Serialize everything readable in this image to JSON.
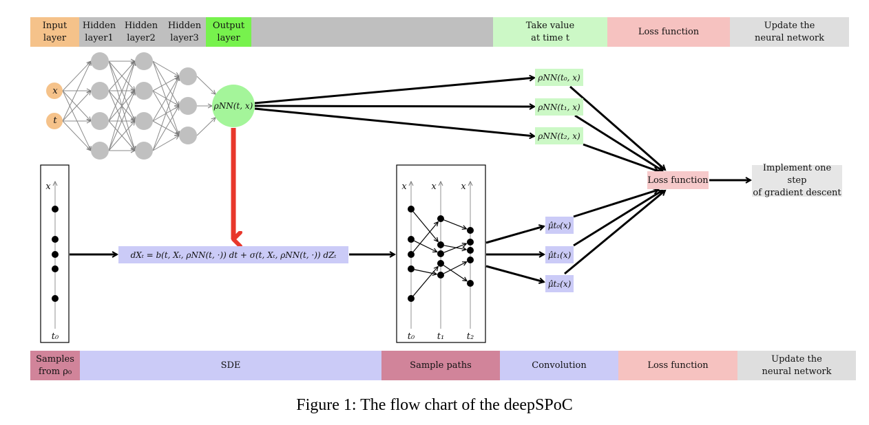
{
  "colors": {
    "input": "#f5c28a",
    "hidden": "#bfbfbf",
    "output": "#77f24d",
    "take_value": "#ccf8c6",
    "loss": "#f6c2c0",
    "update": "#dedede",
    "samples": "#d1849a",
    "sde": "#cbcbf7",
    "convolution": "#cbcbf7",
    "sample_paths": "#d1849a",
    "output_node": "#a4f59a",
    "red_arrow": "#e8372b"
  },
  "top_bar": [
    {
      "key": "input",
      "label": "Input\nlayer"
    },
    {
      "key": "hidden",
      "label": "Hidden\nlayer1"
    },
    {
      "key": "hidden",
      "label": "Hidden\nlayer2"
    },
    {
      "key": "hidden",
      "label": "Hidden\nlayer3"
    },
    {
      "key": "output",
      "label": "Output\nlayer"
    },
    {
      "key": "hidden",
      "label": ""
    },
    {
      "key": "take_value",
      "label": "Take value\nat time t"
    },
    {
      "key": "loss",
      "label": "Loss function"
    },
    {
      "key": "update",
      "label": "Update the\nneural network"
    }
  ],
  "bottom_bar": [
    {
      "key": "samples",
      "label": "Samples\nfrom ρ₀"
    },
    {
      "key": "sde",
      "label": "SDE"
    },
    {
      "key": "sample_paths",
      "label": "Sample paths"
    },
    {
      "key": "convolution",
      "label": "Convolution"
    },
    {
      "key": "loss",
      "label": "Loss function"
    },
    {
      "key": "update",
      "label": "Update the\nneural network"
    }
  ],
  "network": {
    "inputs": [
      "x",
      "t"
    ],
    "hidden_layer_sizes": [
      4,
      4,
      3
    ],
    "output": "ρNN(t, x)"
  },
  "rho_outputs": [
    "ρNN(t₀, x)",
    "ρNN(t₁, x)",
    "ρNN(t₂, x)"
  ],
  "mu_outputs": [
    "μ̂t₀(x)",
    "μ̂t₁(x)",
    "μ̂t₂(x)"
  ],
  "loss_node": "Loss function",
  "gradient_node": "Implement one step\nof gradient descent",
  "sde_equation": "dXₜ = b(t, Xₜ, ρNN(t, ·)) dt + σ(t, Xₜ, ρNN(t, ·)) dZₜ",
  "samples_panel": {
    "axis_label": "x",
    "time_label": "t₀",
    "points": 5
  },
  "paths_panel": {
    "axis_labels": [
      "x",
      "x",
      "x"
    ],
    "time_labels": [
      "t₀",
      "t₁",
      "t₂"
    ]
  },
  "caption": "Figure 1: The flow chart of the deepSPoC"
}
